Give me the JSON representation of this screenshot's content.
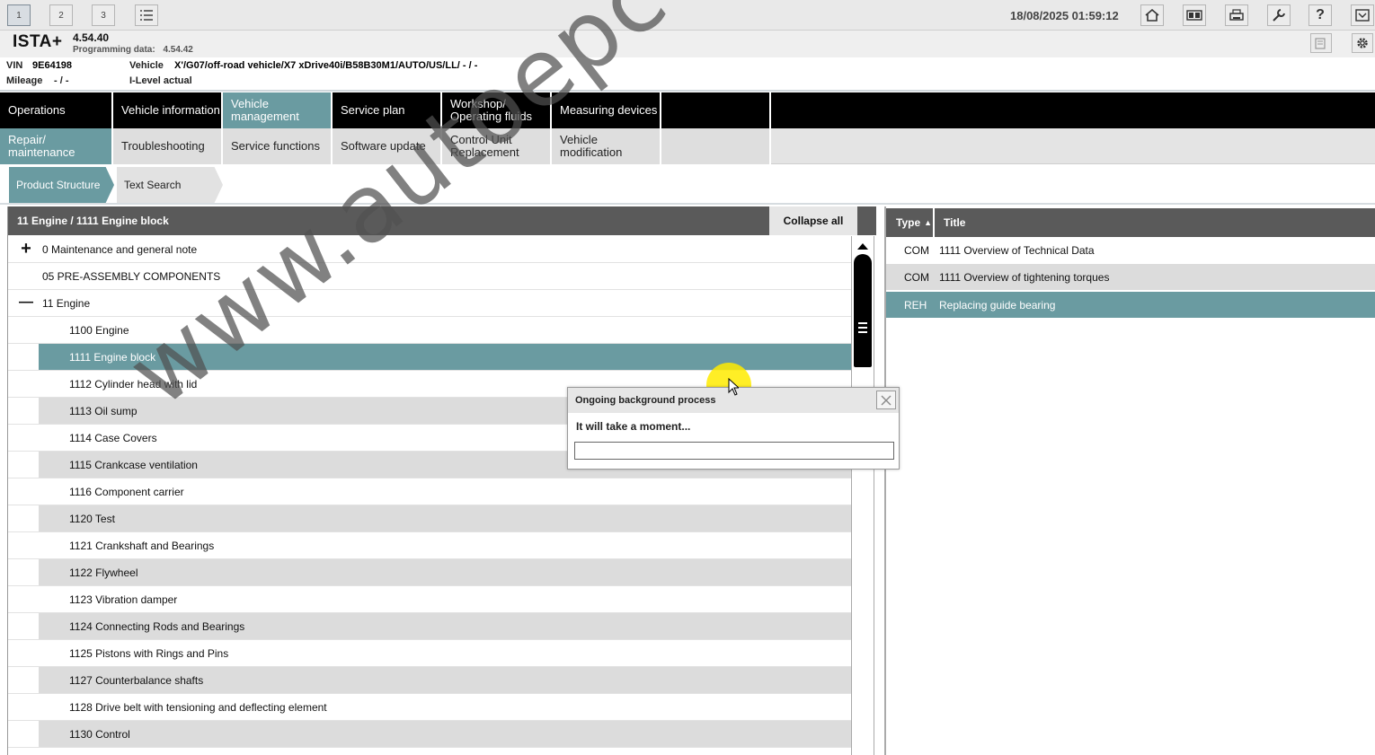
{
  "toolbar": {
    "tabs": [
      "1",
      "2",
      "3"
    ],
    "datetime": "18/08/2025 01:59:12"
  },
  "app": {
    "brand": "ISTA+",
    "version": "4.54.40",
    "programming_data_label": "Programming data:",
    "programming_data_value": "4.54.42"
  },
  "vehicle": {
    "vin_label": "VIN",
    "vin_value": "9E64198",
    "vehicle_label": "Vehicle",
    "vehicle_value": "X'/G07/off-road vehicle/X7 xDrive40i/B58B30M1/AUTO/US/LL/ - / -",
    "mileage_label": "Mileage",
    "mileage_value": "- / -",
    "ilevel_label": "I-Level actual"
  },
  "main_nav": [
    {
      "label": "Operations"
    },
    {
      "label": "Vehicle information"
    },
    {
      "label": "Vehicle management"
    },
    {
      "label": "Service plan"
    },
    {
      "label": "Workshop/ Operating fluids"
    },
    {
      "label": "Measuring devices"
    }
  ],
  "sub_nav": [
    {
      "label": "Repair/ maintenance"
    },
    {
      "label": "Troubleshooting"
    },
    {
      "label": "Service functions"
    },
    {
      "label": "Software update"
    },
    {
      "label": "Control Unit Replacement"
    },
    {
      "label": "Vehicle modification"
    }
  ],
  "third_nav": [
    {
      "label": "Product Structure"
    },
    {
      "label": "Text Search"
    }
  ],
  "tree": {
    "breadcrumb": "11 Engine / 1111 Engine block",
    "collapse_label": "Collapse all",
    "rows": [
      {
        "label": "0 Maintenance and general note",
        "expander": "+"
      },
      {
        "label": "05 PRE-ASSEMBLY COMPONENTS",
        "expander": ""
      },
      {
        "label": "11 Engine",
        "expander": "—"
      },
      {
        "label": "1100 Engine"
      },
      {
        "label": "1111 Engine block"
      },
      {
        "label": "1112 Cylinder head with lid"
      },
      {
        "label": "1113 Oil sump"
      },
      {
        "label": "1114 Case Covers"
      },
      {
        "label": "1115 Crankcase ventilation"
      },
      {
        "label": "1116 Component carrier"
      },
      {
        "label": "1120 Test"
      },
      {
        "label": "1121 Crankshaft and Bearings"
      },
      {
        "label": "1122 Flywheel"
      },
      {
        "label": "1123 Vibration damper"
      },
      {
        "label": "1124 Connecting Rods and Bearings"
      },
      {
        "label": "1125 Pistons with Rings and Pins"
      },
      {
        "label": "1127 Counterbalance shafts"
      },
      {
        "label": "1128 Drive belt with tensioning and deflecting element"
      },
      {
        "label": "1130 Control"
      }
    ]
  },
  "docs": {
    "col_type": "Type",
    "sort_indicator": "▲",
    "col_title": "Title",
    "rows": [
      {
        "type": "COM",
        "title": "1111 Overview of Technical Data"
      },
      {
        "type": "COM",
        "title": "1111 Overview of tightening torques"
      },
      {
        "type": "REH",
        "title": "Replacing guide bearing"
      }
    ]
  },
  "dialog": {
    "title": "Ongoing background process",
    "message": "It will take a moment..."
  },
  "watermark": "www.autoepccatalog.com",
  "colors": {
    "accent": "#6a9ba1",
    "nav": "#000000",
    "header_bar": "#5a5a5a"
  }
}
